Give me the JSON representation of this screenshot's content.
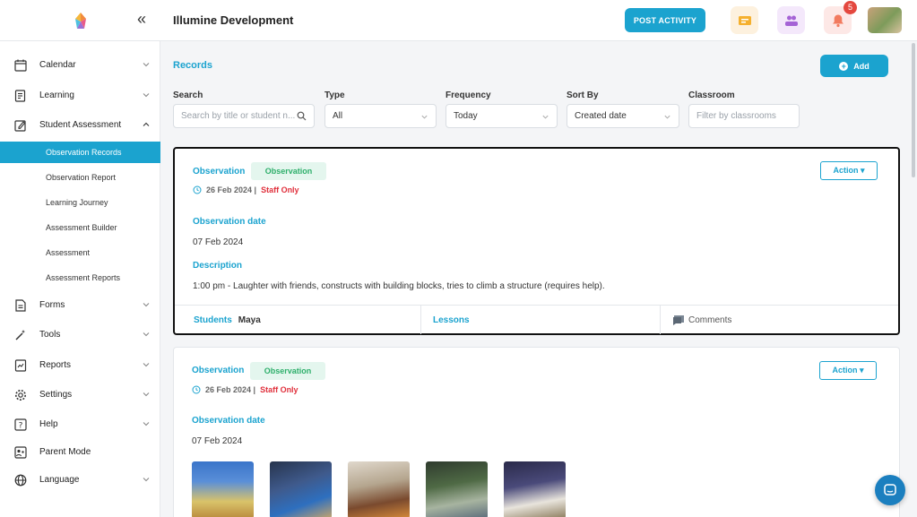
{
  "header": {
    "app_title": "Illumine Development",
    "post_activity_label": "POST ACTIVITY",
    "notification_count": "5"
  },
  "sidebar": {
    "items": [
      {
        "label": "Calendar"
      },
      {
        "label": "Learning"
      },
      {
        "label": "Student Assessment"
      },
      {
        "label": "Forms"
      },
      {
        "label": "Tools"
      },
      {
        "label": "Reports"
      },
      {
        "label": "Settings"
      },
      {
        "label": "Help"
      },
      {
        "label": "Parent Mode"
      },
      {
        "label": "Language"
      }
    ],
    "sub_items": [
      {
        "label": "Observation Records"
      },
      {
        "label": "Observation Report"
      },
      {
        "label": "Learning Journey"
      },
      {
        "label": "Assessment Builder"
      },
      {
        "label": "Assessment"
      },
      {
        "label": "Assessment Reports"
      }
    ]
  },
  "main": {
    "title": "Records",
    "add_label": "Add",
    "filters": {
      "search": {
        "label": "Search",
        "placeholder": "Search by title or student n..."
      },
      "type": {
        "label": "Type",
        "value": "All"
      },
      "frequency": {
        "label": "Frequency",
        "value": "Today"
      },
      "sort_by": {
        "label": "Sort By",
        "value": "Created date"
      },
      "classroom": {
        "label": "Classroom",
        "placeholder": "Filter by classrooms"
      }
    },
    "cards": [
      {
        "type_label": "Observation",
        "pill": "Observation",
        "date": "26 Feb 2024 |",
        "visibility": "Staff Only",
        "action_label": "Action ▾",
        "obs_date_title": "Observation date",
        "obs_date": "07 Feb 2024",
        "description_title": "Description",
        "description": "1:00 pm - Laughter with friends, constructs with building blocks, tries to climb a structure (requires help).",
        "students_label": "Students",
        "student_name": "Maya",
        "lessons_label": "Lessons",
        "comments_label": "Comments"
      },
      {
        "type_label": "Observation",
        "pill": "Observation",
        "date": "26 Feb 2024 |",
        "visibility": "Staff Only",
        "action_label": "Action ▾",
        "obs_date_title": "Observation date",
        "obs_date": "07 Feb 2024"
      }
    ]
  },
  "colors": {
    "accent": "#1ba3cf",
    "staff_only": "#e0303c",
    "pill_bg": "#e4f6ee",
    "pill_text": "#2eaf6b"
  }
}
